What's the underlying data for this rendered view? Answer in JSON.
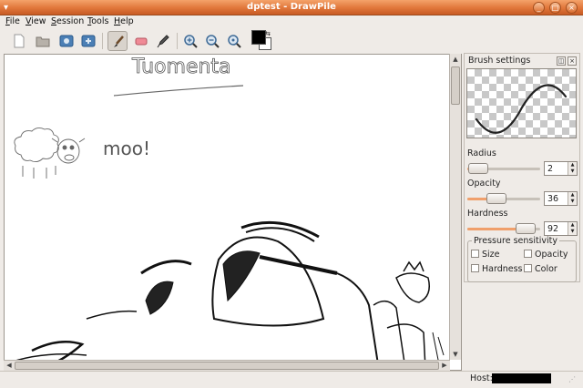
{
  "window": {
    "title": "dptest - DrawPile",
    "buttons": [
      "_",
      "□",
      "×"
    ]
  },
  "menu": {
    "items": [
      {
        "accel": "F",
        "rest": "ile"
      },
      {
        "accel": "V",
        "rest": "iew"
      },
      {
        "accel": "S",
        "rest": "ession"
      },
      {
        "accel": "T",
        "rest": "ools"
      },
      {
        "accel": "H",
        "rest": "elp"
      }
    ]
  },
  "toolbar": {
    "tools": [
      "new-icon",
      "open-icon",
      "save-icon",
      "save-as-icon",
      "brush-icon",
      "eraser-icon",
      "color-picker-icon",
      "zoom-in-icon",
      "zoom-out-icon",
      "zoom-original-icon"
    ],
    "active_tool": "brush",
    "foreground_color": "#000000",
    "background_color": "#ffffff"
  },
  "canvas": {
    "handwriting": [
      "Tuomenta",
      "moo!"
    ]
  },
  "brush_settings": {
    "title": "Brush settings",
    "radius": {
      "label": "Radius",
      "value": "2",
      "level": 0.02
    },
    "opacity": {
      "label": "Opacity",
      "value": "36",
      "level": 0.36
    },
    "hardness": {
      "label": "Hardness",
      "value": "92",
      "level": 0.92
    },
    "pressure": {
      "title": "Pressure sensitivity",
      "size": "Size",
      "opacity": "Opacity",
      "hardness": "Hardness",
      "color": "Color"
    },
    "accent": "#f0a06c"
  },
  "statusbar": {
    "host_label": "Host:"
  }
}
